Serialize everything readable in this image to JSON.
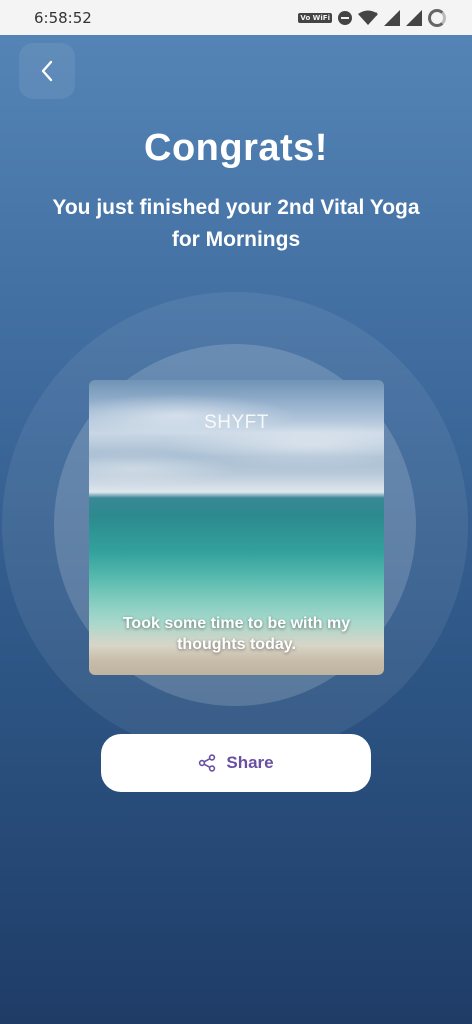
{
  "status_bar": {
    "time": "6:58:52",
    "volte_label": "Vo WiFi",
    "icons": [
      "volte-wifi-icon",
      "do-not-disturb-icon",
      "wifi-icon",
      "signal-icon",
      "signal-icon",
      "loading-ring-icon"
    ]
  },
  "header": {
    "back_icon": "chevron-left-icon"
  },
  "main": {
    "title": "Congrats!",
    "subtitle": "You just finished your 2nd Vital Yoga for Mornings"
  },
  "card": {
    "brand": "SHYFT",
    "caption": "Took some time to be with my thoughts today."
  },
  "share": {
    "label": "Share",
    "icon": "share-icon"
  },
  "colors": {
    "gradient_top": "#5484b6",
    "gradient_bottom": "#1f3c67",
    "accent": "#6a4fa3",
    "text": "#ffffff"
  }
}
